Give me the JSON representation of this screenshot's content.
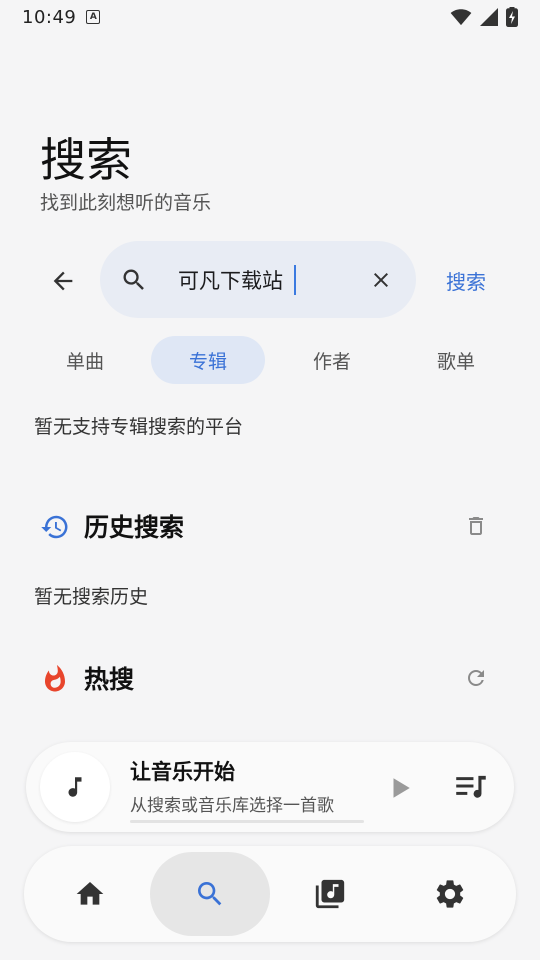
{
  "status_bar": {
    "time": "10:49",
    "notification_icon": "a-badge-icon",
    "icons": [
      "wifi-icon",
      "cell-signal-icon",
      "battery-charging-icon"
    ]
  },
  "header": {
    "title": "搜索",
    "subtitle": "找到此刻想听的音乐"
  },
  "search": {
    "value": "可凡下载站",
    "submit_label": "搜索"
  },
  "tabs": [
    {
      "label": "单曲",
      "active": false
    },
    {
      "label": "专辑",
      "active": true
    },
    {
      "label": "作者",
      "active": false
    },
    {
      "label": "歌单",
      "active": false
    }
  ],
  "results": {
    "message": "暂无支持专辑搜索的平台"
  },
  "history": {
    "title": "历史搜索",
    "empty_message": "暂无搜索历史",
    "icon": "history-icon",
    "action_icon": "delete-icon"
  },
  "hot": {
    "title": "热搜",
    "icon": "flame-icon",
    "action_icon": "refresh-icon"
  },
  "player": {
    "title": "让音乐开始",
    "subtitle": "从搜索或音乐库选择一首歌",
    "progress": 0
  },
  "bottom_nav": {
    "items": [
      {
        "icon": "home-icon",
        "active": false
      },
      {
        "icon": "search-icon",
        "active": true
      },
      {
        "icon": "library-icon",
        "active": false
      },
      {
        "icon": "settings-icon",
        "active": false
      }
    ]
  },
  "colors": {
    "accent": "#3a72d6",
    "hot": "#e8452c",
    "background": "#f5f5f6",
    "search_box": "#e8ecf4",
    "tab_active_bg": "#dfe7f5"
  }
}
